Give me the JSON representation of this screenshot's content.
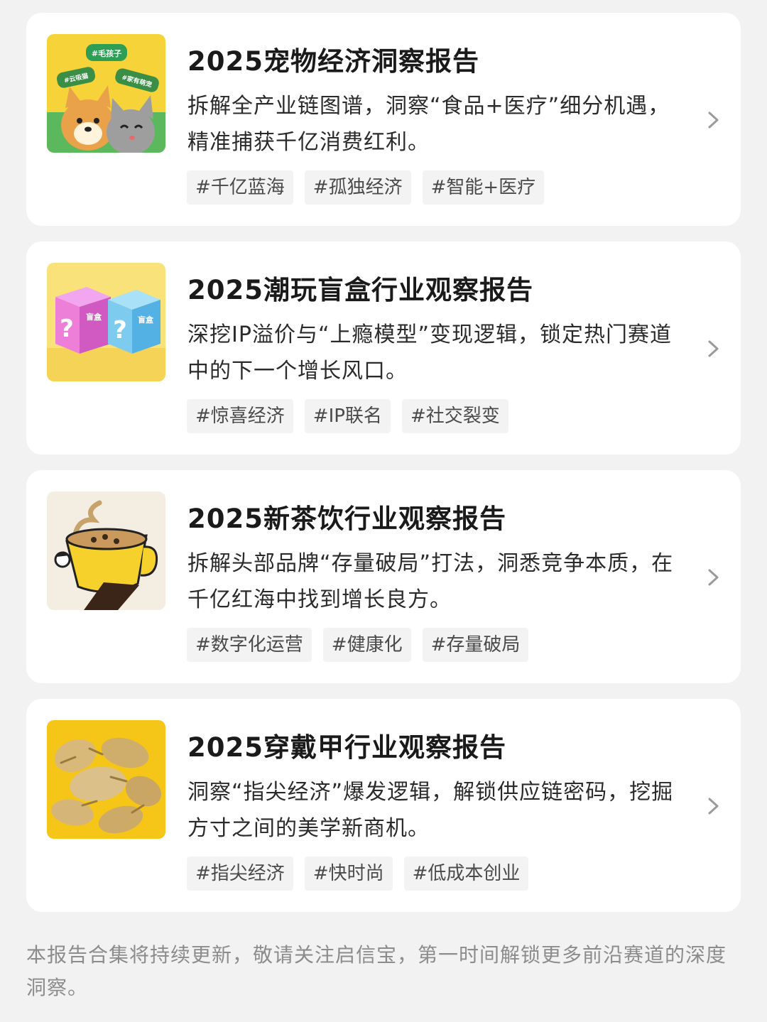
{
  "reports": [
    {
      "title": "2025宠物经济洞察报告",
      "description": "拆解全产业链图谱，洞察“食品+医疗”细分机遇，精准捕获千亿消费红利。",
      "tags": [
        "#千亿蓝海",
        "#孤独经济",
        "#智能+医疗"
      ],
      "thumb_labels": [
        "#毛孩子",
        "#云吸猫",
        "#家有萌宠"
      ]
    },
    {
      "title": "2025潮玩盲盒行业观察报告",
      "description": "深挖IP溢价与“上瘾模型”变现逻辑，锁定热门赛道中的下一个增长风口。",
      "tags": [
        "#惊喜经济",
        "#IP联名",
        "#社交裂变"
      ],
      "thumb_labels": [
        "盲盒",
        "盲盒"
      ]
    },
    {
      "title": "2025新茶饮行业观察报告",
      "description": "拆解头部品牌“存量破局”打法，洞悉竞争本质，在千亿红海中找到增长良方。",
      "tags": [
        "#数字化运营",
        "#健康化",
        "#存量破局"
      ]
    },
    {
      "title": "2025穿戴甲行业观察报告",
      "description": "洞察“指尖经济”爆发逻辑，解锁供应链密码，挖掘方寸之间的美学新商机。",
      "tags": [
        "#指尖经济",
        "#快时尚",
        "#低成本创业"
      ]
    }
  ],
  "footer": "本报告合集将持续更新，敬请关注启信宝，第一时间解锁更多前沿赛道的深度洞察。",
  "colors": {
    "background": "#f2f2f2",
    "card": "#ffffff",
    "tag_bg": "#f3f3f3",
    "footer_text": "#8c8c8c"
  }
}
